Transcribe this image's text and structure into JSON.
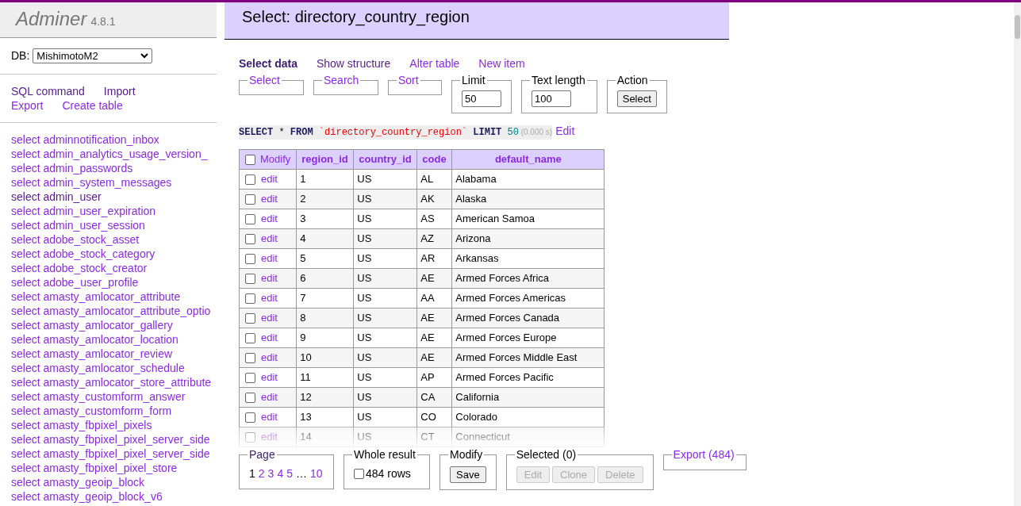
{
  "app": {
    "name": "Adminer",
    "version": "4.8.1"
  },
  "db": {
    "label": "DB:",
    "value": "MishimotoM2"
  },
  "sidebar_links": [
    {
      "label": "SQL command",
      "visited": true
    },
    {
      "label": "Import",
      "visited": true
    },
    {
      "label": "Export",
      "visited": false
    },
    {
      "label": "Create table",
      "visited": false
    }
  ],
  "tables": [
    {
      "label": "select adminnotification_inbox",
      "visited": false
    },
    {
      "label": "select admin_analytics_usage_version_",
      "visited": false
    },
    {
      "label": "select admin_passwords",
      "visited": false
    },
    {
      "label": "select admin_system_messages",
      "visited": false
    },
    {
      "label": "select admin_user",
      "visited": true
    },
    {
      "label": "select admin_user_expiration",
      "visited": false
    },
    {
      "label": "select admin_user_session",
      "visited": false
    },
    {
      "label": "select adobe_stock_asset",
      "visited": false
    },
    {
      "label": "select adobe_stock_category",
      "visited": false
    },
    {
      "label": "select adobe_stock_creator",
      "visited": false
    },
    {
      "label": "select adobe_user_profile",
      "visited": false
    },
    {
      "label": "select amasty_amlocator_attribute",
      "visited": false
    },
    {
      "label": "select amasty_amlocator_attribute_optio",
      "visited": false
    },
    {
      "label": "select amasty_amlocator_gallery",
      "visited": false
    },
    {
      "label": "select amasty_amlocator_location",
      "visited": false
    },
    {
      "label": "select amasty_amlocator_review",
      "visited": false
    },
    {
      "label": "select amasty_amlocator_schedule",
      "visited": false
    },
    {
      "label": "select amasty_amlocator_store_attribute",
      "visited": false
    },
    {
      "label": "select amasty_customform_answer",
      "visited": false
    },
    {
      "label": "select amasty_customform_form",
      "visited": false
    },
    {
      "label": "select amasty_fbpixel_pixels",
      "visited": false
    },
    {
      "label": "select amasty_fbpixel_pixel_server_side",
      "visited": false
    },
    {
      "label": "select amasty_fbpixel_pixel_server_side",
      "visited": false
    },
    {
      "label": "select amasty_fbpixel_pixel_store",
      "visited": false
    },
    {
      "label": "select amasty_geoip_block",
      "visited": false
    },
    {
      "label": "select amasty_geoip_block_v6",
      "visited": false
    }
  ],
  "title": "Select: directory_country_region",
  "tabs": [
    {
      "label": "Select data",
      "selected": true
    },
    {
      "label": "Show structure",
      "selected": false,
      "visited": true
    },
    {
      "label": "Alter table",
      "selected": false,
      "visited": false
    },
    {
      "label": "New item",
      "selected": false,
      "visited": false
    }
  ],
  "filters": [
    {
      "kind": "link",
      "legend": "Select"
    },
    {
      "kind": "link",
      "legend": "Search"
    },
    {
      "kind": "link",
      "legend": "Sort"
    },
    {
      "kind": "input",
      "legend": "Limit",
      "value": "50"
    },
    {
      "kind": "input",
      "legend": "Text length",
      "value": "100"
    },
    {
      "kind": "button",
      "legend": "Action",
      "button": "Select"
    }
  ],
  "query": {
    "tokens": [
      {
        "kind": "keyword",
        "text": "SELECT"
      },
      {
        "kind": "plain",
        "text": "*"
      },
      {
        "kind": "keyword",
        "text": "FROM"
      },
      {
        "kind": "identifier",
        "text": "`directory_country_region`"
      },
      {
        "kind": "keyword",
        "text": "LIMIT"
      },
      {
        "kind": "number",
        "text": "50"
      }
    ],
    "time": "(0.000 s)",
    "edit": "Edit"
  },
  "table": {
    "all_checked": false,
    "modify": "Modify",
    "columns": [
      "region_id",
      "country_id",
      "code",
      "default_name"
    ],
    "rows": [
      {
        "checked": false,
        "edit": "edit",
        "cells": [
          "1",
          "US",
          "AL",
          "Alabama"
        ]
      },
      {
        "checked": false,
        "edit": "edit",
        "cells": [
          "2",
          "US",
          "AK",
          "Alaska"
        ]
      },
      {
        "checked": false,
        "edit": "edit",
        "cells": [
          "3",
          "US",
          "AS",
          "American Samoa"
        ]
      },
      {
        "checked": false,
        "edit": "edit",
        "cells": [
          "4",
          "US",
          "AZ",
          "Arizona"
        ]
      },
      {
        "checked": false,
        "edit": "edit",
        "cells": [
          "5",
          "US",
          "AR",
          "Arkansas"
        ]
      },
      {
        "checked": false,
        "edit": "edit",
        "cells": [
          "6",
          "US",
          "AE",
          "Armed Forces Africa"
        ]
      },
      {
        "checked": false,
        "edit": "edit",
        "cells": [
          "7",
          "US",
          "AA",
          "Armed Forces Americas"
        ]
      },
      {
        "checked": false,
        "edit": "edit",
        "cells": [
          "8",
          "US",
          "AE",
          "Armed Forces Canada"
        ]
      },
      {
        "checked": false,
        "edit": "edit",
        "cells": [
          "9",
          "US",
          "AE",
          "Armed Forces Europe"
        ]
      },
      {
        "checked": false,
        "edit": "edit",
        "cells": [
          "10",
          "US",
          "AE",
          "Armed Forces Middle East"
        ]
      },
      {
        "checked": false,
        "edit": "edit",
        "cells": [
          "11",
          "US",
          "AP",
          "Armed Forces Pacific"
        ]
      },
      {
        "checked": false,
        "edit": "edit",
        "cells": [
          "12",
          "US",
          "CA",
          "California"
        ]
      },
      {
        "checked": false,
        "edit": "edit",
        "cells": [
          "13",
          "US",
          "CO",
          "Colorado"
        ]
      },
      {
        "checked": false,
        "edit": "edit",
        "cells": [
          "14",
          "US",
          "CT",
          "Connecticut"
        ]
      }
    ]
  },
  "footer": {
    "page_legend": "Page",
    "pages": [
      {
        "label": "1",
        "selected": true
      },
      {
        "label": "2",
        "selected": false
      },
      {
        "label": "3",
        "selected": false
      },
      {
        "label": "4",
        "selected": false
      },
      {
        "label": "5",
        "selected": false
      },
      {
        "label": "…",
        "kind": "gap"
      },
      {
        "label": "10",
        "selected": false
      }
    ],
    "whole_legend": "Whole result",
    "whole_checked": false,
    "whole_label": "484 rows",
    "modify_legend": "Modify",
    "save": "Save",
    "selected_legend": "Selected (0)",
    "selected_buttons": [
      {
        "label": "Edit",
        "disabled": true
      },
      {
        "label": "Clone",
        "disabled": true
      },
      {
        "label": "Delete",
        "disabled": true
      }
    ],
    "export": "Export (484)"
  }
}
